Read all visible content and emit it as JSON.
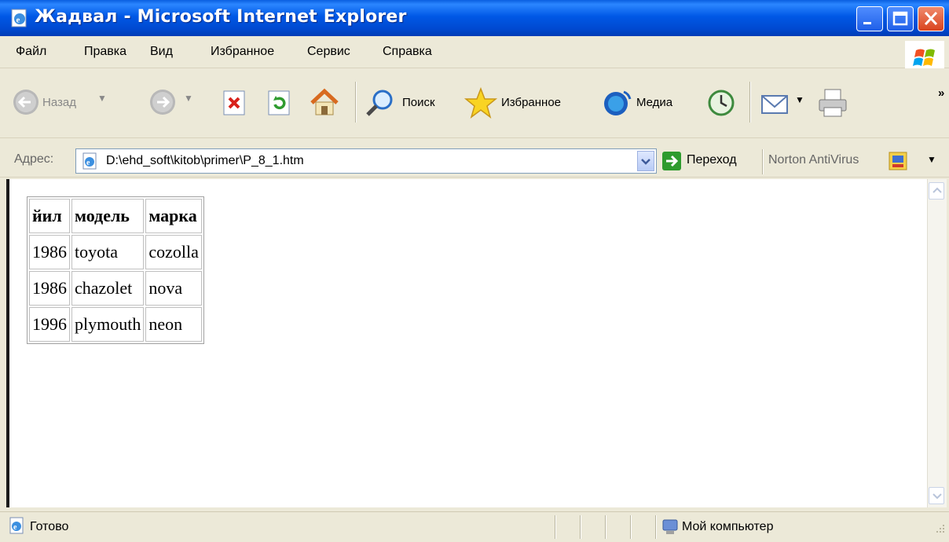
{
  "window": {
    "title": "Жадвал - Microsoft Internet Explorer"
  },
  "menu": [
    "Файл",
    "Правка",
    "Вид",
    "Избранное",
    "Сервис",
    "Справка"
  ],
  "toolbar": {
    "back": "Назад",
    "search": "Поиск",
    "favorites": "Избранное",
    "media": "Медиа",
    "more": "»"
  },
  "address": {
    "label": "Адрес:",
    "value": "D:\\ehd_soft\\kitob\\primer\\P_8_1.htm",
    "go": "Переход",
    "norton": "Norton AntiVirus"
  },
  "table": {
    "headers": [
      "йил",
      "модель",
      "марка"
    ],
    "rows": [
      [
        "1986",
        "toyota",
        "cozolla"
      ],
      [
        "1986",
        "chazolet",
        "nova"
      ],
      [
        "1996",
        "plymouth",
        "neon"
      ]
    ]
  },
  "status": {
    "text": "Готово",
    "zone": "Мой компьютер"
  },
  "colors": {
    "titlebar": "#0058e6",
    "close": "#d9431d",
    "panel": "#ece9d8"
  },
  "icons": [
    "ie-page-icon",
    "minimize-icon",
    "maximize-icon",
    "close-icon",
    "windows-logo-icon",
    "back-icon",
    "forward-icon",
    "stop-icon",
    "refresh-icon",
    "home-icon",
    "search-icon",
    "favorites-star-icon",
    "media-icon",
    "history-icon",
    "mail-icon",
    "print-icon",
    "go-arrow-icon",
    "norton-icon",
    "computer-icon"
  ]
}
